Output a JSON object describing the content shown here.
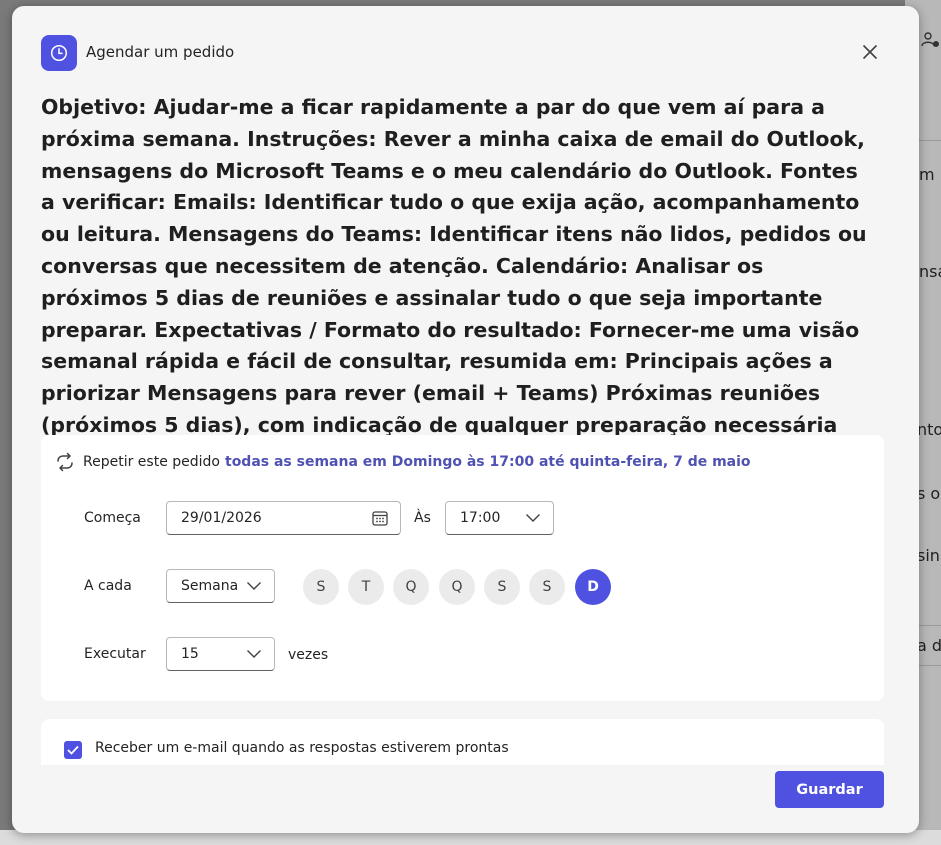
{
  "header": {
    "title": "Agendar um pedido",
    "icon": "clock-icon"
  },
  "prompt_text": "Objetivo: Ajudar-me a ficar rapidamente a par do que vem aí para a próxima semana. Instruções: Rever a minha caixa de email do Outlook, mensagens do Microsoft Teams e o meu calendário do Outlook. Fontes a verificar: Emails: Identificar tudo o que exija ação, acompanhamento ou leitura. Mensagens do Teams: Identificar itens não lidos, pedidos ou conversas que necessitem de atenção. Calendário: Analisar os próximos 5 dias de reuniões e assinalar tudo o que seja importante preparar. Expectativas / Formato do resultado: Fornecer-me uma visão semanal rápida e fácil de consultar, resumida em: Principais ações a priorizar Mensagens para rever (email + Teams) Próximas reuniões (próximos 5 dias), com indicação de qualquer preparação necessária",
  "schedule": {
    "repeat_label": "Repetir este pedido",
    "repeat_summary": "todas as semana em Domingo às 17:00 até quinta-feira, 7 de maio",
    "start_label": "Começa",
    "start_date": "29/01/2026",
    "at_label": "Às",
    "time_value": "17:00",
    "every_label": "A cada",
    "frequency_value": "Semana",
    "days": [
      {
        "letter": "S",
        "selected": false
      },
      {
        "letter": "T",
        "selected": false
      },
      {
        "letter": "Q",
        "selected": false
      },
      {
        "letter": "Q",
        "selected": false
      },
      {
        "letter": "S",
        "selected": false
      },
      {
        "letter": "S",
        "selected": false
      },
      {
        "letter": "D",
        "selected": true
      }
    ],
    "run_label": "Executar",
    "run_count": "15",
    "times_label": "vezes"
  },
  "notify": {
    "checked": true,
    "label": "Receber um e-mail quando as respostas estiverem prontas"
  },
  "footer": {
    "save_label": "Guardar"
  },
  "background": {
    "fragments": [
      "m",
      "nsa",
      "nto",
      "s ou",
      "sina",
      "a d"
    ]
  },
  "colors": {
    "accent": "#4f52e0",
    "link": "#4f52b2",
    "dialog_bg": "#f5f5f5"
  }
}
